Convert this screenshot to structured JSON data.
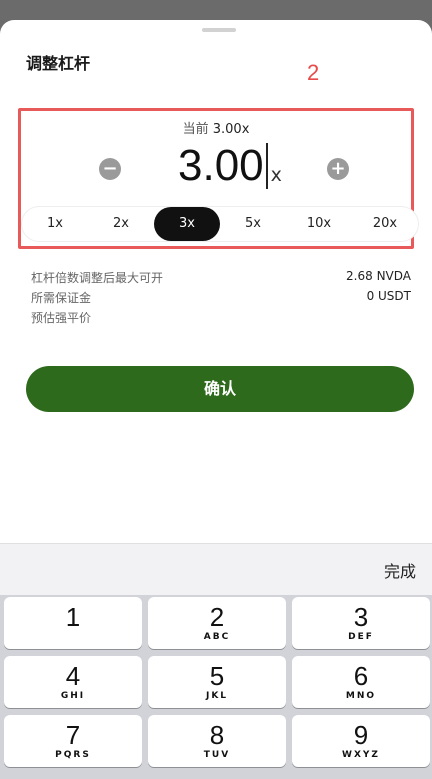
{
  "sheet": {
    "title": "调整杠杆"
  },
  "annotation": {
    "number": "2"
  },
  "leverage": {
    "current_prefix": "当前",
    "current_value": "3.00x",
    "minus_symbol": "−",
    "plus_symbol": "+",
    "input_value": "3.00",
    "unit": "x",
    "options": [
      "1x",
      "2x",
      "3x",
      "5x",
      "10x",
      "20x"
    ],
    "selected": "3x"
  },
  "info": [
    {
      "label": "杠杆倍数调整后最大可开",
      "value": "2.68 NVDA"
    },
    {
      "label": "所需保证金",
      "value": "0 USDT"
    },
    {
      "label": "预估强平价",
      "value": ""
    }
  ],
  "confirm_label": "确认",
  "keyboard": {
    "done_label": "完成",
    "keys": [
      {
        "num": "1",
        "letters": ""
      },
      {
        "num": "2",
        "letters": "ABC"
      },
      {
        "num": "3",
        "letters": "DEF"
      },
      {
        "num": "4",
        "letters": "GHI"
      },
      {
        "num": "5",
        "letters": "JKL"
      },
      {
        "num": "6",
        "letters": "MNO"
      },
      {
        "num": "7",
        "letters": "PQRS"
      },
      {
        "num": "8",
        "letters": "TUV"
      },
      {
        "num": "9",
        "letters": "WXYZ"
      }
    ]
  }
}
